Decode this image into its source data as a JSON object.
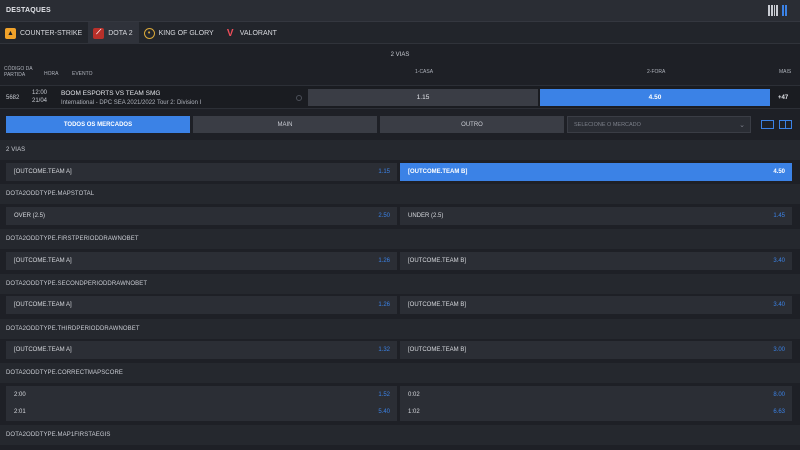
{
  "header": {
    "title": "DESTAQUES"
  },
  "sports": [
    {
      "label": "COUNTER-STRIKE",
      "icon": "counter-strike-icon"
    },
    {
      "label": "DOTA 2",
      "icon": "dota2-icon"
    },
    {
      "label": "KING OF GLORY",
      "icon": "king-of-glory-icon"
    },
    {
      "label": "VALORANT",
      "icon": "valorant-icon"
    }
  ],
  "market_group": "2 VIAS",
  "columns": {
    "code": "CÓDIGO DA PARTIDA",
    "time": "HORA",
    "event": "EVENTO",
    "home": "1-CASA",
    "away": "2-FORA",
    "more": "MAIS"
  },
  "event": {
    "code": "5682",
    "time": "12:00",
    "date": "21/04",
    "teams": "BOOM ESPORTS  VS  TEAM SMG",
    "league": "International - DPC SEA 2021/2022 Tour 2: Division I",
    "home_odd": "1.15",
    "away_odd": "4.50",
    "more": "+47"
  },
  "filters": {
    "all": "TODOS OS MERCADOS",
    "main": "MAIN",
    "other": "OUTRO",
    "select_placeholder": "SELECIONE O MERCADO"
  },
  "markets": [
    {
      "title": "2 VIAS",
      "rows": [
        [
          {
            "label": "[OUTCOME.TEAM A]",
            "price": "1.15"
          },
          {
            "label": "[OUTCOME.TEAM B]",
            "price": "4.50"
          }
        ]
      ]
    },
    {
      "title": "DOTA2ODDTYPE.MAPSTOTAL",
      "rows": [
        [
          {
            "label": "OVER (2.5)",
            "price": "2.50"
          },
          {
            "label": "UNDER (2.5)",
            "price": "1.45"
          }
        ]
      ]
    },
    {
      "title": "DOTA2ODDTYPE.FIRSTPERIODDRAWNOBET",
      "rows": [
        [
          {
            "label": "[OUTCOME.TEAM A]",
            "price": "1.26"
          },
          {
            "label": "[OUTCOME.TEAM B]",
            "price": "3.40"
          }
        ]
      ]
    },
    {
      "title": "DOTA2ODDTYPE.SECONDPERIODDRAWNOBET",
      "rows": [
        [
          {
            "label": "[OUTCOME.TEAM A]",
            "price": "1.26"
          },
          {
            "label": "[OUTCOME.TEAM B]",
            "price": "3.40"
          }
        ]
      ]
    },
    {
      "title": "DOTA2ODDTYPE.THIRDPERIODDRAWNOBET",
      "rows": [
        [
          {
            "label": "[OUTCOME.TEAM A]",
            "price": "1.32"
          },
          {
            "label": "[OUTCOME.TEAM B]",
            "price": "3.00"
          }
        ]
      ]
    },
    {
      "title": "DOTA2ODDTYPE.CORRECTMAPSCORE",
      "rows": [
        [
          {
            "label": "2:00",
            "price": "1.52"
          },
          {
            "label": "0:02",
            "price": "8.00"
          }
        ],
        [
          {
            "label": "2:01",
            "price": "5.40"
          },
          {
            "label": "1:02",
            "price": "6.63"
          }
        ]
      ]
    },
    {
      "title": "DOTA2ODDTYPE.MAP1FIRSTAEGIS",
      "rows": []
    }
  ],
  "colors": {
    "accent": "#3b82e6",
    "background": "#1e2026",
    "row": "#2b2e35"
  }
}
